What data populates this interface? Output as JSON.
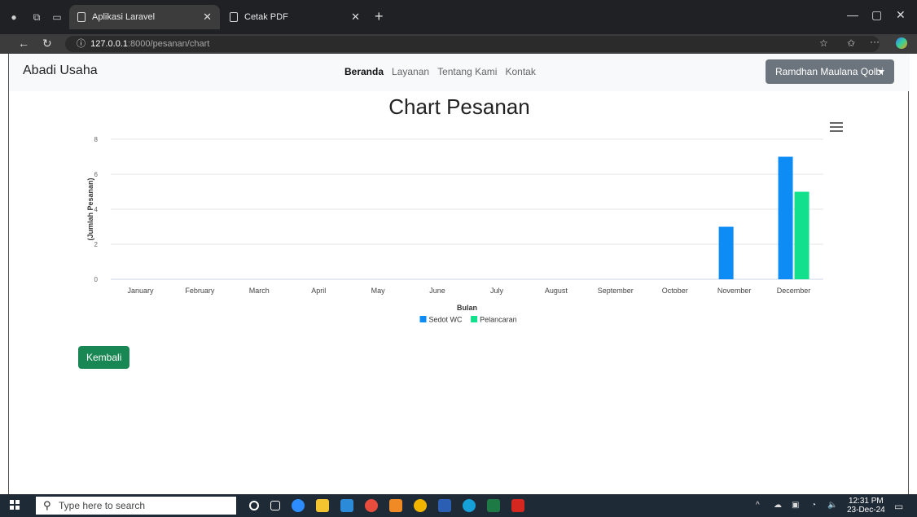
{
  "browser": {
    "tabs": [
      {
        "label": "Aplikasi Laravel",
        "active": true
      },
      {
        "label": "Cetak PDF",
        "active": false
      }
    ],
    "url": {
      "host": "127.0.0.1",
      "path": ":8000/pesanan/chart"
    }
  },
  "navbar": {
    "brand": "Abadi Usaha",
    "links": [
      {
        "label": "Beranda",
        "active": true
      },
      {
        "label": "Layanan",
        "active": false
      },
      {
        "label": "Tentang Kami",
        "active": false
      },
      {
        "label": "Kontak",
        "active": false
      }
    ],
    "user": "Ramdhan Maulana Qolbi"
  },
  "page": {
    "title": "Chart Pesanan",
    "back_button": "Kembali"
  },
  "chart_data": {
    "type": "bar",
    "title": "",
    "xlabel": "Bulan",
    "ylabel": "(Jumlah Pesanan)",
    "categories": [
      "January",
      "February",
      "March",
      "April",
      "May",
      "June",
      "July",
      "August",
      "September",
      "October",
      "November",
      "December"
    ],
    "series": [
      {
        "name": "Sedot WC",
        "color": "#0d8cf5",
        "values": [
          0,
          0,
          0,
          0,
          0,
          0,
          0,
          0,
          0,
          0,
          3,
          7
        ]
      },
      {
        "name": "Pelancaran",
        "color": "#12e08c",
        "values": [
          0,
          0,
          0,
          0,
          0,
          0,
          0,
          0,
          0,
          0,
          0,
          5
        ]
      }
    ],
    "ylim": [
      0,
      8
    ],
    "yticks": [
      0,
      2,
      4,
      6,
      8
    ],
    "grid": true,
    "legend": "bottom-center"
  },
  "taskbar": {
    "search_placeholder": "Type here to search",
    "time": "12:31 PM",
    "date": "23-Dec-24"
  }
}
